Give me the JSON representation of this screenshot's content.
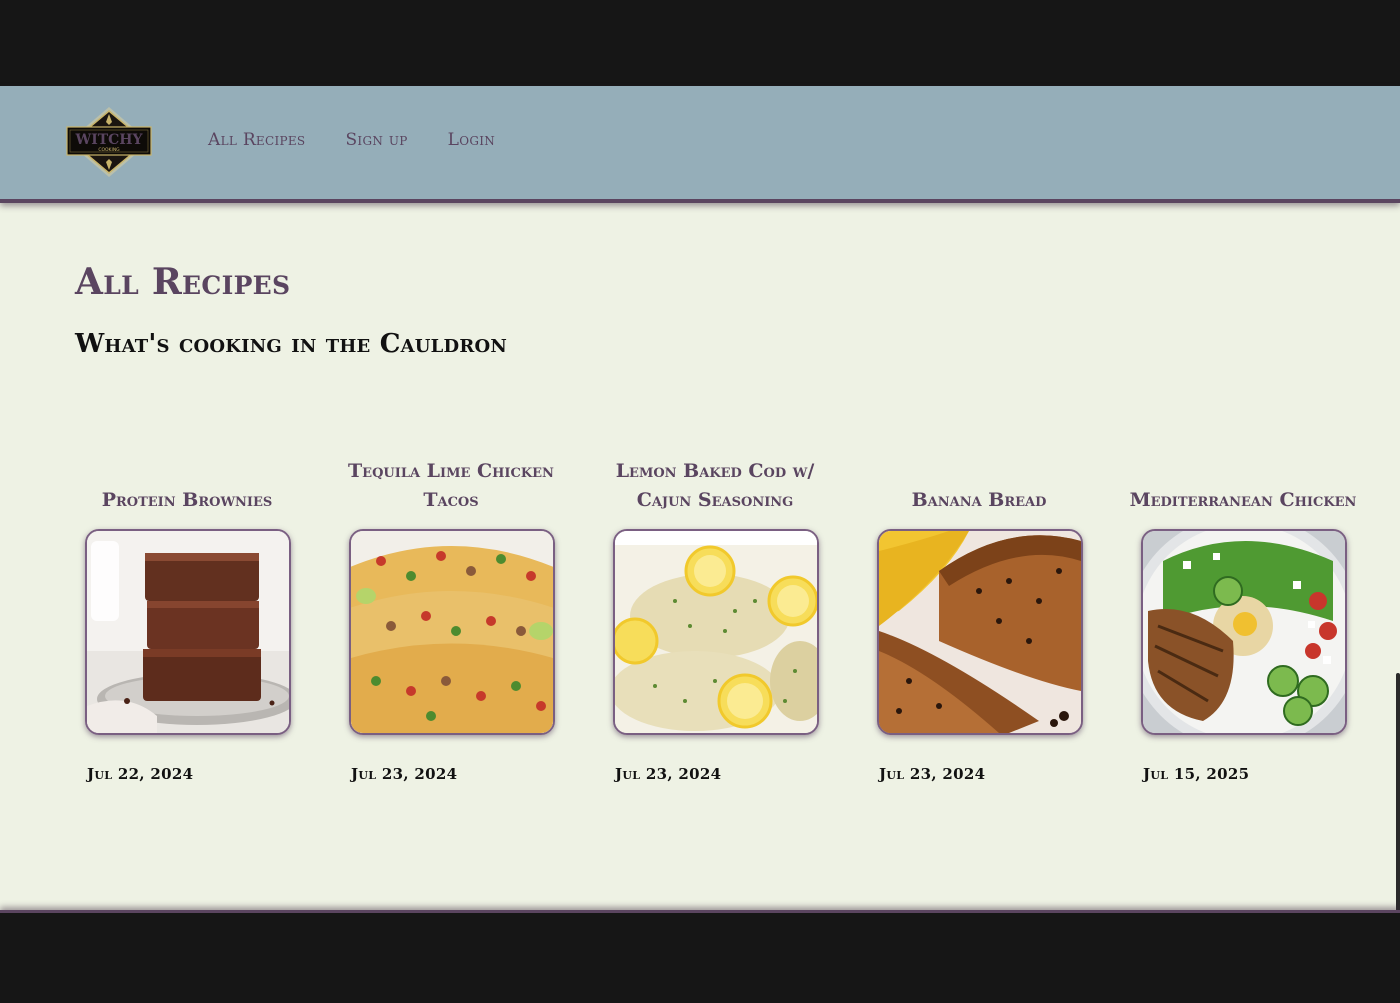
{
  "nav": {
    "logo_text": "WITCHY",
    "logo_subtext": "COOKING",
    "links": [
      {
        "label": "All Recipes"
      },
      {
        "label": "Sign up"
      },
      {
        "label": "Login"
      }
    ]
  },
  "main": {
    "title": "All Recipes",
    "subtitle": "What's cooking in the Cauldron"
  },
  "recipes": [
    {
      "title": "Protein Brownies",
      "date": "Jul 22, 2024",
      "image": "brownies-photo"
    },
    {
      "title": "Tequila Lime Chicken Tacos",
      "date": "Jul 23, 2024",
      "image": "tacos-photo"
    },
    {
      "title": "Lemon Baked Cod w/ Cajun Seasoning",
      "date": "Jul 23, 2024",
      "image": "cod-photo"
    },
    {
      "title": "Banana Bread",
      "date": "Jul 23, 2024",
      "image": "banana-bread-photo"
    },
    {
      "title": "Mediterranean Chicken",
      "date": "Jul 15, 2025",
      "image": "chicken-salad-photo"
    }
  ],
  "colors": {
    "navbar": "#95aeb9",
    "accent_purple": "#5a4560",
    "page_background": "#eef2e4",
    "frame_dark": "#161616"
  }
}
